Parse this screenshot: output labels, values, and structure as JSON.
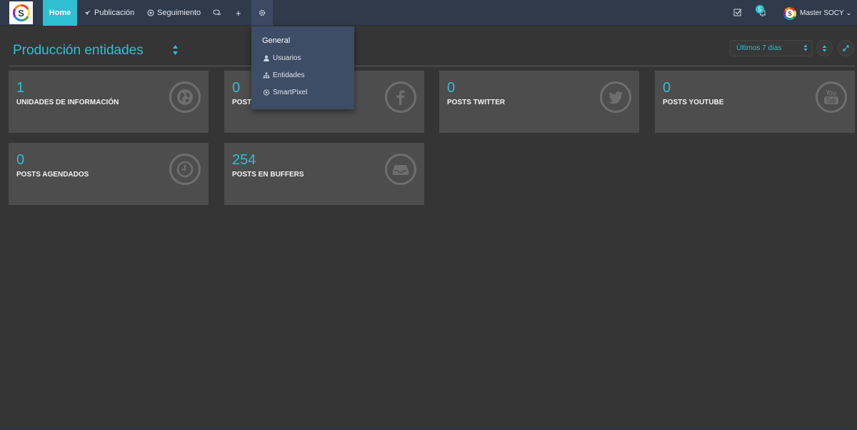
{
  "topbar": {
    "logo_letter": "S",
    "home": "Home",
    "publicacion": "Publicación",
    "seguimiento": "Seguimiento",
    "plus": "+",
    "notification_count": "5",
    "user_name": "Master SOCY",
    "user_caret": "⌄"
  },
  "dropdown": {
    "header": "General",
    "items": [
      {
        "label": "Usuarios",
        "icon": "user-icon"
      },
      {
        "label": "Entidades",
        "icon": "sitemap-icon"
      },
      {
        "label": "SmartPixel",
        "icon": "target-icon"
      }
    ]
  },
  "page": {
    "title": "Producción entidades",
    "date_range": "Últimos 7 días"
  },
  "cards": [
    {
      "value": "1",
      "label": "UNIDADES DE INFORMACIÓN",
      "icon": "globe-icon"
    },
    {
      "value": "0",
      "label": "POSTS FACEBOOK",
      "icon": "facebook-icon"
    },
    {
      "value": "0",
      "label": "POSTS TWITTER",
      "icon": "twitter-icon"
    },
    {
      "value": "0",
      "label": "POSTS YOUTUBE",
      "icon": "youtube-icon"
    },
    {
      "value": "0",
      "label": "POSTS AGENDADOS",
      "icon": "clock-icon"
    },
    {
      "value": "254",
      "label": "POSTS EN BUFFERS",
      "icon": "inbox-icon"
    }
  ],
  "colors": {
    "accent": "#2ebfd3",
    "topbar": "#2f3a4b",
    "background": "#353535",
    "card": "#4d4d4d",
    "dropdown": "#3e4c66"
  }
}
